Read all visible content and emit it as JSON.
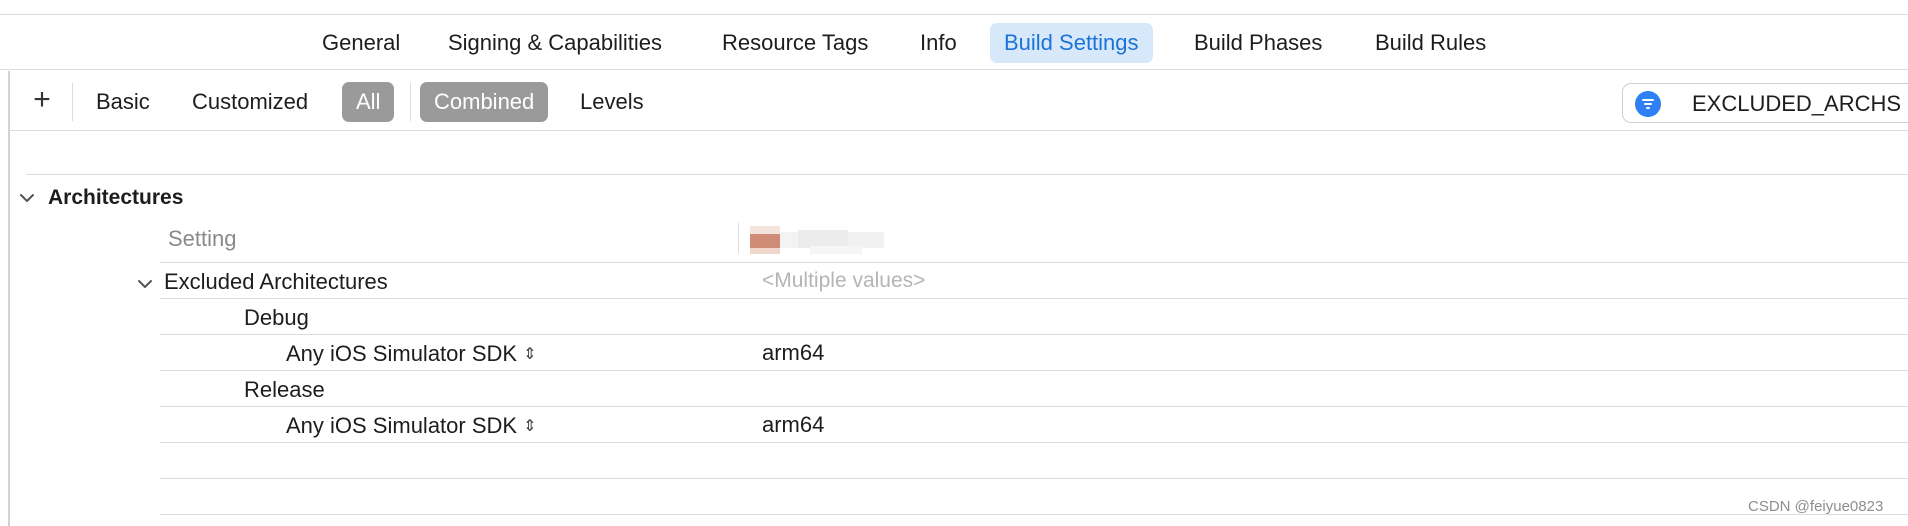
{
  "tabs": [
    {
      "label": "General",
      "active": false
    },
    {
      "label": "Signing & Capabilities",
      "active": false
    },
    {
      "label": "Resource Tags",
      "active": false
    },
    {
      "label": "Info",
      "active": false
    },
    {
      "label": "Build Settings",
      "active": true
    },
    {
      "label": "Build Phases",
      "active": false
    },
    {
      "label": "Build Rules",
      "active": false
    }
  ],
  "filterbar": {
    "add_icon": "plus-icon",
    "scope": [
      "Basic",
      "Customized",
      "All"
    ],
    "scope_selected": "All",
    "view": [
      "Combined",
      "Levels"
    ],
    "view_selected": "Combined",
    "search_icon": "filter-icon",
    "search_value": "EXCLUDED_ARCHS"
  },
  "section": {
    "title": "Architectures",
    "setting_header": "Setting",
    "rows": [
      {
        "label": "Excluded Architectures",
        "value": "<Multiple values>"
      },
      {
        "label": "Debug",
        "value": ""
      },
      {
        "label": "Any iOS Simulator SDK",
        "value": "arm64"
      },
      {
        "label": "Release",
        "value": ""
      },
      {
        "label": "Any iOS Simulator SDK",
        "value": "arm64"
      }
    ]
  },
  "colors": {
    "accent": "#1a73d9",
    "active_tab_bg": "#d8e8fb",
    "selected_segment_bg": "#9a9a9a",
    "filter_icon": "#2f7ff5"
  },
  "watermark": "CSDN @feiyue0823"
}
